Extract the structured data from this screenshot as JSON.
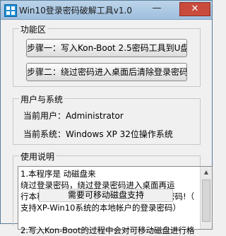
{
  "window": {
    "title": "Win10登录密码破解工具v1.0",
    "minimize": "—",
    "close": "✕"
  },
  "group_functions": {
    "title": "功能区",
    "step1": "步骤一：写入Kon-Boot 2.5密码工具到U盘",
    "step2": "步骤二：绕过密码进入桌面后清除登录密码"
  },
  "group_user": {
    "title": "用户与系统",
    "current_user": "当前用户：Administrator",
    "current_system": "当前系统：Windows XP  32位操作系统"
  },
  "group_help": {
    "title": "使用说明",
    "para1": "1.本程序是                              动磁盘来\n绕过登录密码，绕过登录密码进入桌面再运\n行本程序，点击步骤二即可清除系统登录密码!（\n支持XP-Win10系统的本地帐户的登录密码）",
    "para2": "2.写入Kon-Boot的过程中会对可移动磁盘进行格",
    "popup": "需要可移动磁盘支持"
  },
  "icons": {
    "app": "app-icon",
    "scroll_up": "scroll-up-icon"
  }
}
